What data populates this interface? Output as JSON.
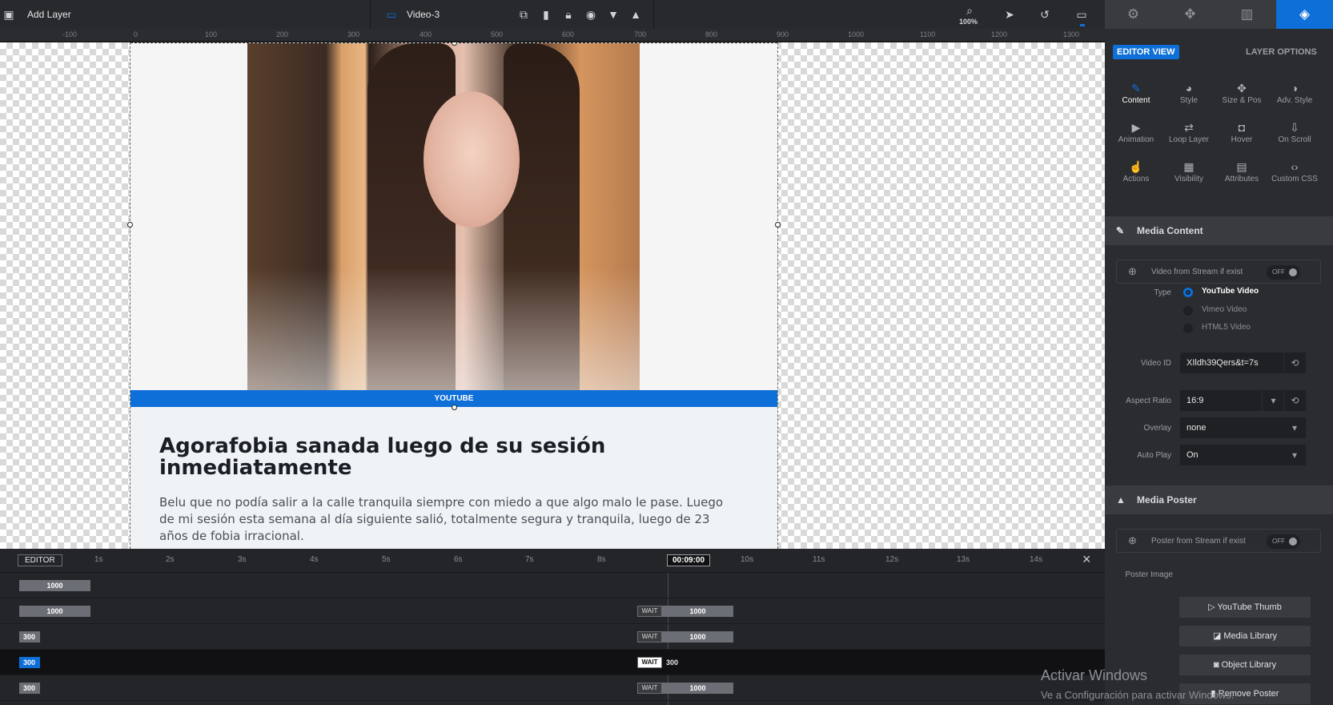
{
  "topbar": {
    "add_layer": "Add Layer",
    "layer_name": "Video-3",
    "zoom": "100%"
  },
  "right_tabs": [
    "gear-icon",
    "puzzle-icon",
    "gallery-icon",
    "layers-icon"
  ],
  "ruler": {
    "ticks": [
      "-100",
      "0",
      "100",
      "200",
      "300",
      "400",
      "500",
      "600",
      "700",
      "800",
      "900",
      "1000",
      "1100",
      "1200",
      "1300"
    ]
  },
  "canvas": {
    "video_badge": "YOUTUBE",
    "title": "Agorafobia sanada luego de su sesión inmediatamente",
    "body": "Belu que no podía salir a la calle tranquila siempre con miedo a que algo malo le pase. Luego de mi sesión esta semana al día siguiente salió, totalmente segura y tranquila, luego de 23 años de fobia irracional."
  },
  "timeline": {
    "editor_label": "EDITOR",
    "current_time": "00:09:00",
    "seconds": [
      "1s",
      "2s",
      "3s",
      "4s",
      "5s",
      "6s",
      "7s",
      "8s",
      "10s",
      "11s",
      "12s",
      "13s",
      "14s"
    ],
    "rows": [
      {
        "start": "1000",
        "wait": "",
        "end": ""
      },
      {
        "start": "1000",
        "wait": "WAIT",
        "end": "1000"
      },
      {
        "start": "300",
        "wait": "WAIT",
        "end": "1000"
      },
      {
        "start": "300",
        "wait": "WAIT",
        "end": "300"
      },
      {
        "start": "300",
        "wait": "WAIT",
        "end": "1000"
      }
    ]
  },
  "panel": {
    "editor_view": "EDITOR VIEW",
    "layer_options": "LAYER OPTIONS",
    "options": [
      {
        "label": "Content",
        "icon": "pencil-icon"
      },
      {
        "label": "Style",
        "icon": "palette-icon"
      },
      {
        "label": "Size & Pos",
        "icon": "move-icon"
      },
      {
        "label": "Adv. Style",
        "icon": "contrast-icon"
      },
      {
        "label": "Animation",
        "icon": "play-icon"
      },
      {
        "label": "Loop Layer",
        "icon": "loop-icon"
      },
      {
        "label": "Hover",
        "icon": "mouse-icon"
      },
      {
        "label": "On Scroll",
        "icon": "download-icon"
      },
      {
        "label": "Actions",
        "icon": "hand-icon"
      },
      {
        "label": "Visibility",
        "icon": "visibility-icon"
      },
      {
        "label": "Attributes",
        "icon": "file-icon"
      },
      {
        "label": "Custom CSS",
        "icon": "code-icon"
      }
    ],
    "media_content": {
      "title": "Media Content",
      "stream_label": "Video from Stream if exist",
      "stream_toggle": "OFF",
      "type_label": "Type",
      "types": [
        "YouTube Video",
        "Vimeo Video",
        "HTML5 Video"
      ],
      "video_id_label": "Video ID",
      "video_id": "XIldh39Qers&t=7s",
      "aspect_label": "Aspect Ratio",
      "aspect": "16:9",
      "overlay_label": "Overlay",
      "overlay": "none",
      "autoplay_label": "Auto Play",
      "autoplay": "On"
    },
    "media_poster": {
      "title": "Media Poster",
      "stream_label": "Poster from Stream if exist",
      "stream_toggle": "OFF",
      "poster_label": "Poster Image",
      "buttons": [
        "YouTube Thumb",
        "Media Library",
        "Object Library",
        "Remove Poster"
      ]
    }
  },
  "watermark": {
    "line1": "Activar Windows",
    "line2": "Ve a Configuración para activar Windows."
  },
  "colors": {
    "accent": "#0d6fd7",
    "panel": "#2b2c30",
    "topbar": "#28292c"
  }
}
